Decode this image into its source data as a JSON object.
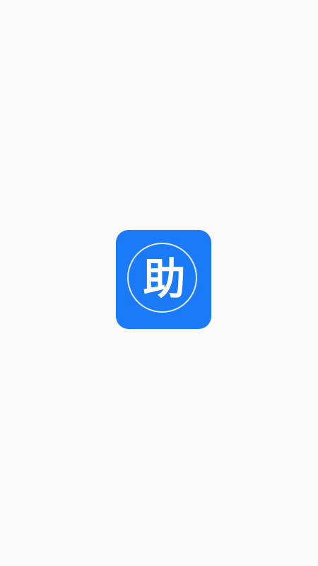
{
  "splash": {
    "logo_glyph": "助",
    "logo_icon": "app-logo-icon",
    "colors": {
      "background": "#fafafa",
      "logo_background": "#1a7af8",
      "logo_foreground": "#ffffff"
    }
  }
}
